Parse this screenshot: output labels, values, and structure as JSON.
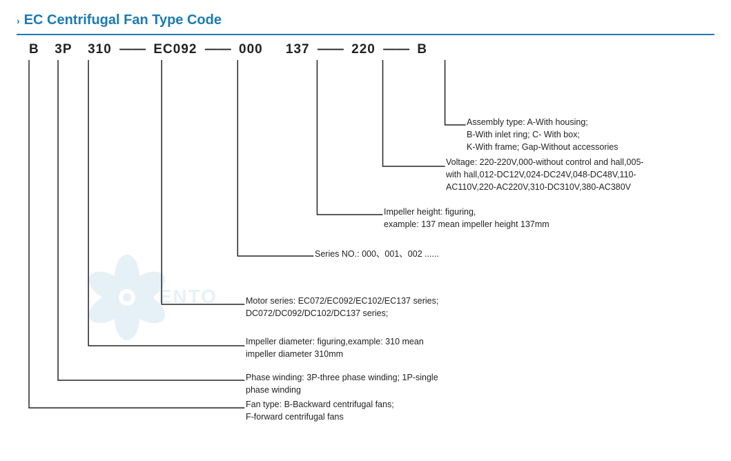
{
  "title": {
    "chevron": "›",
    "text": "EC Centrifugal Fan Type Code"
  },
  "code": {
    "parts": [
      "B",
      "3P",
      "310",
      "EC092",
      "000",
      "137",
      "220",
      "B"
    ],
    "dashes": [
      "—",
      "—",
      "—",
      "—",
      "—",
      "—"
    ]
  },
  "annotations": [
    {
      "id": "assembly",
      "label": "Assembly type:  A-With housing;\nB-With inlet ring;  C- With box;\nK-With frame; Gap-Without accessories"
    },
    {
      "id": "voltage",
      "label": "Voltage:  220-220V,000-without control and hall,005-\nwith hall,012-DC12V,024-DC24V,048-DC48V,110-\nAC110V,220-AC220V,310-DC310V,380-AC380V"
    },
    {
      "id": "impeller-height",
      "label": "Impeller height:   figuring,\nexample: 137 mean impeller height 137mm"
    },
    {
      "id": "series-no",
      "label": "Series NO.:  000、001、002 ......"
    },
    {
      "id": "motor-series",
      "label": "Motor series:  EC072/EC092/EC102/EC137 series;\nDC072/DC092/DC102/DC137 series;"
    },
    {
      "id": "impeller-diameter",
      "label": "Impeller diameter:  figuring,example: 310 mean\nimpeller diameter 310mm"
    },
    {
      "id": "phase-winding",
      "label": "Phase winding:  3P-three phase winding;  1P-single\nphase winding"
    },
    {
      "id": "fan-type",
      "label": "Fan type:  B-Backward centrifugal fans;\nF-forward centrifugal fans"
    }
  ]
}
